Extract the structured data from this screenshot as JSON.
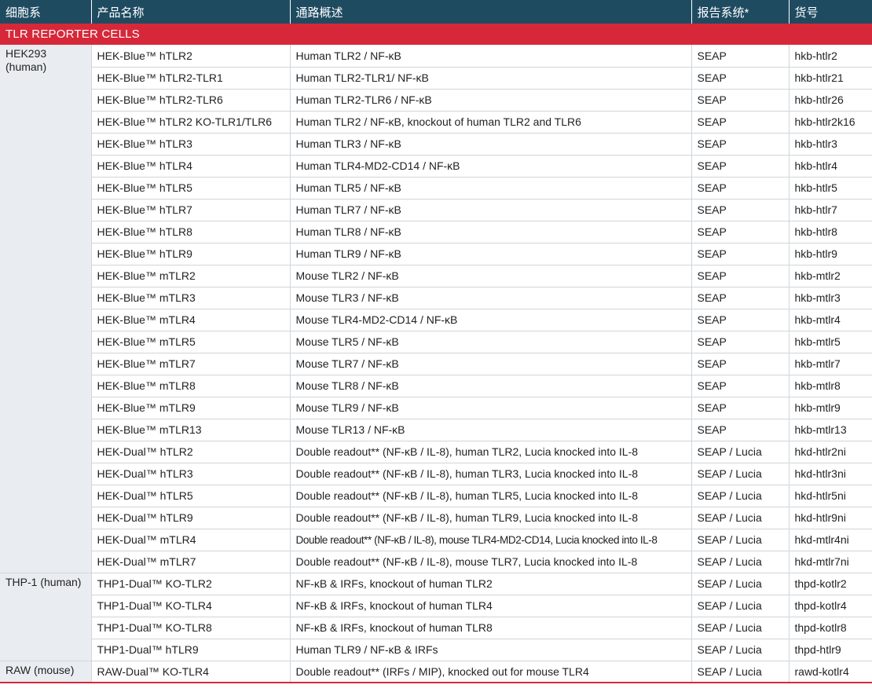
{
  "headers": [
    "细胞系",
    "产品名称",
    "通路概述",
    "报告系统*",
    "货号"
  ],
  "section_title": "TLR REPORTER CELLS",
  "groups": [
    {
      "line": "HEK293 (human)",
      "rows": [
        [
          "HEK-Blue™ hTLR2",
          "Human TLR2 / NF-κB",
          "SEAP",
          "hkb-htlr2"
        ],
        [
          "HEK-Blue™ hTLR2-TLR1",
          "Human TLR2-TLR1/ NF-κB",
          "SEAP",
          "hkb-htlr21"
        ],
        [
          "HEK-Blue™ hTLR2-TLR6",
          "Human TLR2-TLR6 / NF-κB",
          "SEAP",
          "hkb-htlr26"
        ],
        [
          "HEK-Blue™ hTLR2 KO-TLR1/TLR6",
          "Human TLR2 / NF-κB, knockout of human TLR2 and TLR6",
          "SEAP",
          "hkb-htlr2k16"
        ],
        [
          "HEK-Blue™ hTLR3",
          "Human TLR3 / NF-κB",
          "SEAP",
          "hkb-htlr3"
        ],
        [
          "HEK-Blue™ hTLR4",
          "Human TLR4-MD2-CD14 / NF-κB",
          "SEAP",
          "hkb-htlr4"
        ],
        [
          "HEK-Blue™ hTLR5",
          "Human TLR5 / NF-κB",
          "SEAP",
          "hkb-htlr5"
        ],
        [
          "HEK-Blue™ hTLR7",
          "Human TLR7 / NF-κB",
          "SEAP",
          "hkb-htlr7"
        ],
        [
          "HEK-Blue™ hTLR8",
          "Human TLR8 / NF-κB",
          "SEAP",
          "hkb-htlr8"
        ],
        [
          "HEK-Blue™ hTLR9",
          "Human TLR9 / NF-κB",
          "SEAP",
          "hkb-htlr9"
        ],
        [
          "HEK-Blue™ mTLR2",
          "Mouse TLR2 / NF-κB",
          "SEAP",
          "hkb-mtlr2"
        ],
        [
          "HEK-Blue™ mTLR3",
          "Mouse TLR3 / NF-κB",
          "SEAP",
          "hkb-mtlr3"
        ],
        [
          "HEK-Blue™ mTLR4",
          "Mouse TLR4-MD2-CD14 / NF-κB",
          "SEAP",
          "hkb-mtlr4"
        ],
        [
          "HEK-Blue™ mTLR5",
          "Mouse TLR5 / NF-κB",
          "SEAP",
          "hkb-mtlr5"
        ],
        [
          "HEK-Blue™ mTLR7",
          "Mouse TLR7 / NF-κB",
          "SEAP",
          "hkb-mtlr7"
        ],
        [
          "HEK-Blue™ mTLR8",
          "Mouse TLR8 / NF-κB",
          "SEAP",
          "hkb-mtlr8"
        ],
        [
          "HEK-Blue™ mTLR9",
          "Mouse TLR9 / NF-κB",
          "SEAP",
          "hkb-mtlr9"
        ],
        [
          "HEK-Blue™ mTLR13",
          "Mouse TLR13 / NF-κB",
          "SEAP",
          "hkb-mtlr13"
        ],
        [
          "HEK-Dual™ hTLR2",
          "Double readout** (NF-κB / IL-8), human TLR2, Lucia knocked into IL-8",
          "SEAP / Lucia",
          "hkd-htlr2ni"
        ],
        [
          "HEK-Dual™ hTLR3",
          "Double readout** (NF-κB / IL-8), human TLR3, Lucia knocked into IL-8",
          "SEAP / Lucia",
          "hkd-htlr3ni"
        ],
        [
          "HEK-Dual™ hTLR5",
          "Double readout** (NF-κB / IL-8), human TLR5, Lucia knocked into IL-8",
          "SEAP / Lucia",
          "hkd-htlr5ni"
        ],
        [
          "HEK-Dual™ hTLR9",
          "Double readout** (NF-κB / IL-8), human TLR9, Lucia knocked into IL-8",
          "SEAP / Lucia",
          "hkd-htlr9ni"
        ],
        [
          "HEK-Dual™ mTLR4",
          "Double readout** (NF-κB / IL-8), mouse TLR4-MD2-CD14, Lucia knocked into IL-8",
          "SEAP / Lucia",
          "hkd-mtlr4ni"
        ],
        [
          "HEK-Dual™ mTLR7",
          "Double readout** (NF-κB / IL-8), mouse TLR7, Lucia knocked into IL-8",
          "SEAP / Lucia",
          "hkd-mtlr7ni"
        ]
      ]
    },
    {
      "line": "THP-1 (human)",
      "rows": [
        [
          "THP1-Dual™ KO-TLR2",
          "NF-κB & IRFs, knockout of human TLR2",
          "SEAP / Lucia",
          "thpd-kotlr2"
        ],
        [
          "THP1-Dual™ KO-TLR4",
          "NF-κB & IRFs, knockout of human TLR4",
          "SEAP / Lucia",
          "thpd-kotlr4"
        ],
        [
          "THP1-Dual™ KO-TLR8",
          "NF-κB & IRFs, knockout of human TLR8",
          "SEAP / Lucia",
          "thpd-kotlr8"
        ],
        [
          "THP1-Dual™ hTLR9",
          "Human TLR9 / NF-κB & IRFs",
          "SEAP / Lucia",
          "thpd-htlr9"
        ]
      ]
    },
    {
      "line": "RAW (mouse)",
      "rows": [
        [
          "RAW-Dual™ KO-TLR4",
          "Double readout** (IRFs / MIP), knocked out for mouse TLR4",
          "SEAP / Lucia",
          "rawd-kotlr4"
        ]
      ]
    }
  ]
}
